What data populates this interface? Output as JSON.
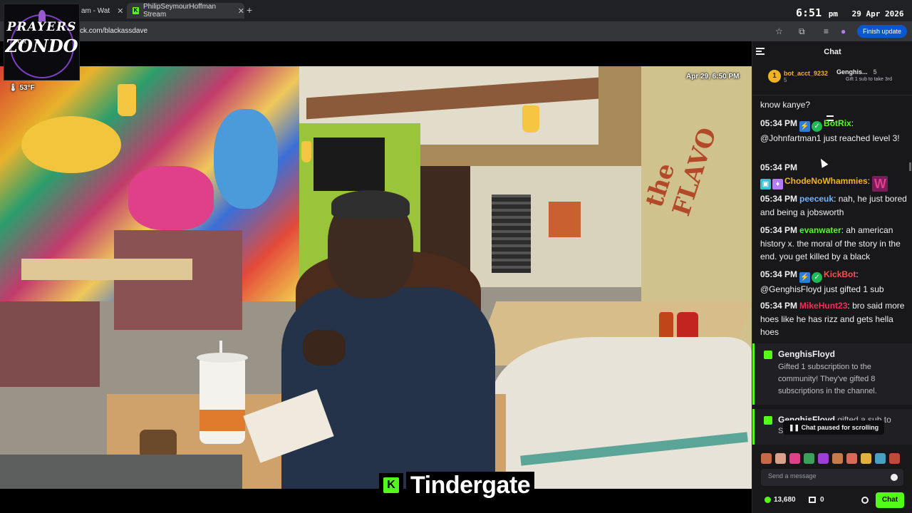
{
  "browser": {
    "tabs": [
      {
        "title": "am - Wat",
        "close": "✕"
      },
      {
        "title": "PhilipSeymourHoffman Stream",
        "close": "✕"
      }
    ],
    "new_tab": "+",
    "url": "ck.com/blackassdave",
    "finish_update": "Finish update",
    "clock": {
      "time": "6:51",
      "ampm": "pm",
      "date": "29 Apr 2026"
    }
  },
  "overlay_logo": {
    "text_top": "PRAYERS",
    "text_for": "FOR",
    "text_main": "ZONDO"
  },
  "video": {
    "timestamp": "Apr 29, 6:50 PM",
    "temperature": "53°F",
    "wall_text": "the FLAVO",
    "caption_logo": "K",
    "caption": "Tindergate"
  },
  "chat": {
    "title": "Chat",
    "leaderboard": [
      {
        "rank": "1",
        "name": "bot_acct_9232",
        "count": "5"
      },
      {
        "name": "Genghis...",
        "count": "5",
        "sub": "Gift 1 sub to take 3rd"
      }
    ],
    "messages": [
      {
        "text": "know kanye?"
      },
      {
        "time": "05:34 PM",
        "user": "BotRix",
        "color": "#53fc18",
        "text": "@Johnfartman1 just reached level 3!"
      },
      {
        "time": "05:34 PM",
        "user": "ChodeNoWhammies",
        "color": "#f0b323",
        "text": ""
      },
      {
        "time": "05:34 PM",
        "user": "peeceuk",
        "color": "#6fb3ff",
        "text": "nah, he just bored and being a jobsworth"
      },
      {
        "time": "05:34 PM",
        "user": "evanwater",
        "color": "#53fc18",
        "text": "ah american history x. the moral of the story in the end. you get killed by a black"
      },
      {
        "time": "05:34 PM",
        "user": "KickBot",
        "color": "#ff4d4d",
        "text": "@GenghisFloyd just gifted 1 sub"
      },
      {
        "time": "05:34 PM",
        "user": "MikeHunt23",
        "color": "#ff2a5a",
        "text": "bro said more hoes like he has rizz and gets hella hoes"
      }
    ],
    "gift1": {
      "user": "GenghisFloyd",
      "text": "Gifted 1 subscription to the community! They've gifted 8 subscriptions in the channel."
    },
    "gift2": {
      "user": "GenghisFloyd",
      "text": "gifted a sub to",
      "cut": "S"
    },
    "paused": "Chat paused for scrolling",
    "input_placeholder": "Send a message",
    "viewers": "13,680",
    "gifts": "0",
    "chat_button": "Chat"
  }
}
